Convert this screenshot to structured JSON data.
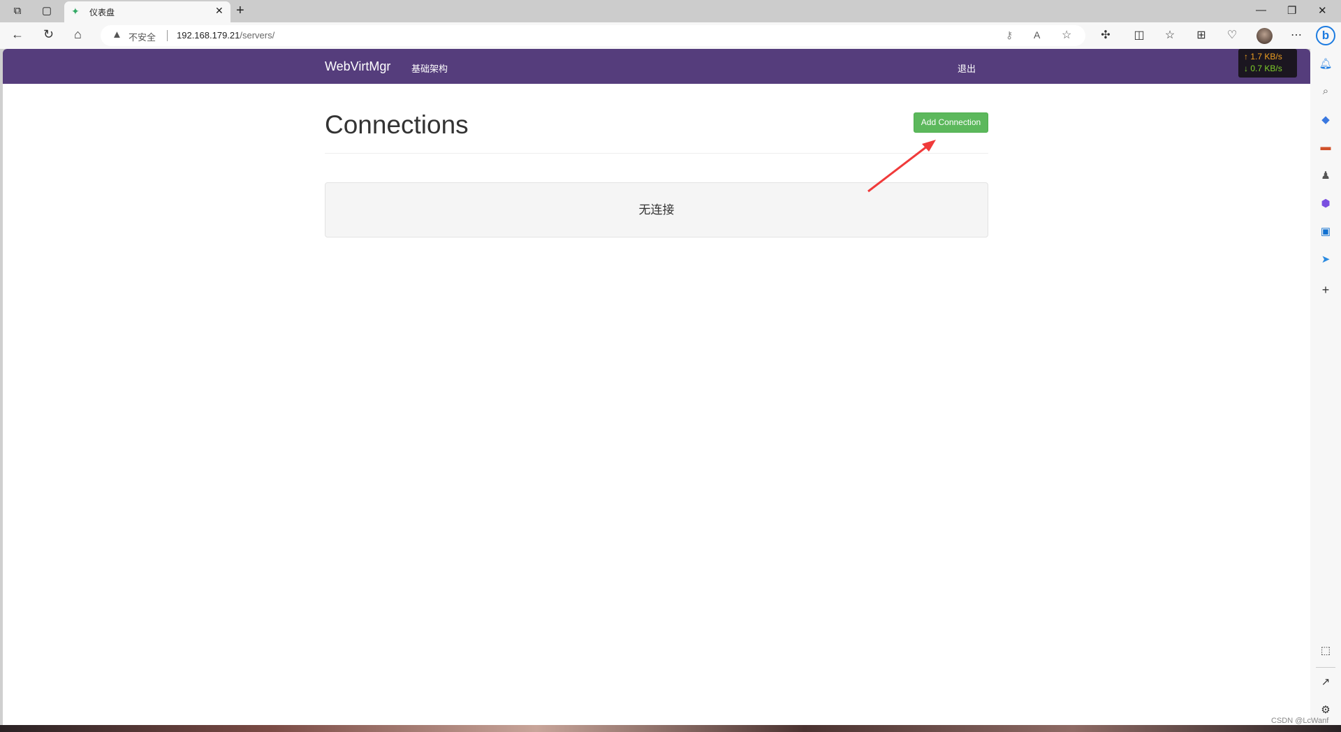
{
  "browser": {
    "tab_title": "仪表盘",
    "security_label": "不安全",
    "url_host": "192.168.179.21",
    "url_path": "/servers/",
    "net_up": "↑ 1.7 KB/s",
    "net_down": "↓ 0.7 KB/s",
    "net_up_color": "#f0a020",
    "net_down_color": "#7fd02a"
  },
  "navbar": {
    "brand": "WebVirtMgr",
    "infrastructure": "基础架构",
    "logout": "退出",
    "color": "#553d7c"
  },
  "main": {
    "title": "Connections",
    "add_button": "Add Connection",
    "empty_message": "无连接",
    "button_color": "#5cb85c"
  },
  "watermark": "CSDN @LcWanf"
}
